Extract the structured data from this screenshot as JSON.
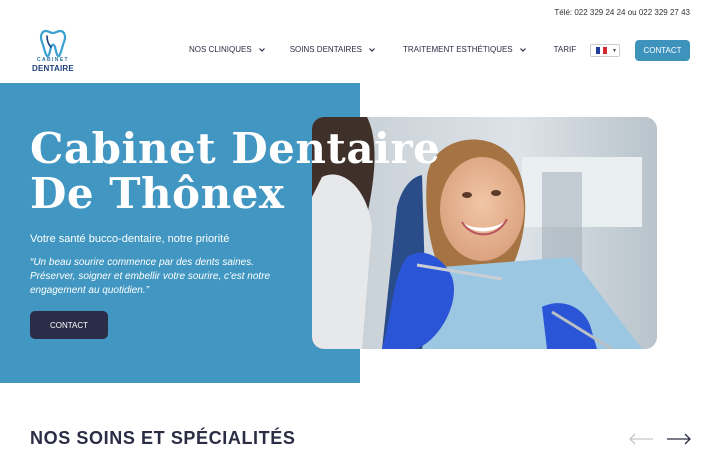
{
  "topbar": {
    "phone_label": "Télé: 022 329 24 24 ou 022 329 27 43"
  },
  "logo": {
    "line1": "CABINET",
    "line2": "DENTAIRE",
    "icon": "tooth-icon"
  },
  "nav": {
    "items": [
      {
        "label": "Nos cliniques",
        "has_dropdown": true
      },
      {
        "label": "Soins dentaires",
        "has_dropdown": true
      },
      {
        "label": "Traitement esthétiques",
        "has_dropdown": true
      },
      {
        "label": "Tarif",
        "has_dropdown": false
      }
    ]
  },
  "language": {
    "selected": "FR",
    "icon": "french-flag-icon"
  },
  "header_button": {
    "label": "Contact"
  },
  "hero": {
    "title": "Cabinet Dentaire De Thônex",
    "subtitle": "Votre santé bucco-dentaire, notre priorité",
    "quote": "“Un beau sourire commence par des dents saines. Préserver, soigner et embellir votre sourire, c’est notre engagement au quotidien.”",
    "button_label": "Contact"
  },
  "section": {
    "title": "Nos soins et spécialités"
  },
  "colors": {
    "accent": "#4197c2",
    "button_dark": "#2b2d48",
    "button_blue": "#3e93bd",
    "text_dark": "#2a2d44"
  }
}
